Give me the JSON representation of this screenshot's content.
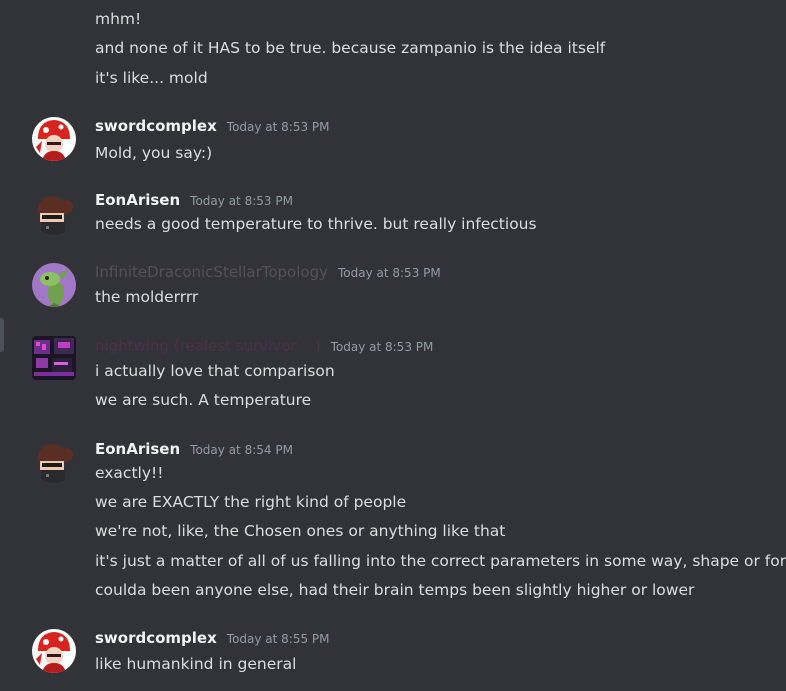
{
  "messages": [
    {
      "continuation": true,
      "lines": [
        "mhm!",
        "and none of it HAS to be true. because zampanio is the idea itself",
        "it's like... mold"
      ]
    },
    {
      "username": "swordcomplex",
      "timestamp": "Today at 8:53 PM",
      "avatar": "red-mushroom-character-avatar",
      "lines": [
        "Mold, you say:)"
      ]
    },
    {
      "username": "EonArisen",
      "timestamp": "Today at 8:53 PM",
      "avatar": "brown-haired-character-avatar",
      "lines": [
        "needs a good temperature to thrive. but really infectious"
      ]
    },
    {
      "username": "InfiniteDraconicStellarTopology",
      "timestamp": "Today at 8:53 PM",
      "avatar": "green-creature-avatar",
      "lines": [
        "the molderrrr"
      ]
    },
    {
      "username": "nightwing (realest survivor ♡)",
      "timestamp": "Today at 8:53 PM",
      "avatar": "purple-pixel-art-avatar",
      "lines": [
        "i actually love that comparison",
        "we are such. A temperature"
      ]
    },
    {
      "username": "EonArisen",
      "timestamp": "Today at 8:54 PM",
      "avatar": "brown-haired-character-avatar",
      "lines": [
        "exactly!!",
        "we are EXACTLY the right kind of people",
        "we're not, like, the Chosen ones or anything like that",
        "it's just a matter of all of us falling into the correct parameters in some way, shape or form",
        "coulda been anyone else, had their brain temps been slightly higher or lower"
      ]
    },
    {
      "username": "swordcomplex",
      "timestamp": "Today at 8:55 PM",
      "avatar": "red-mushroom-character-avatar",
      "lines": [
        "like humankind in general"
      ]
    }
  ],
  "colors": {
    "background": "#313338",
    "text": "#dbdee1",
    "username": "#f2f3f5",
    "timestamp": "#949ba4"
  }
}
